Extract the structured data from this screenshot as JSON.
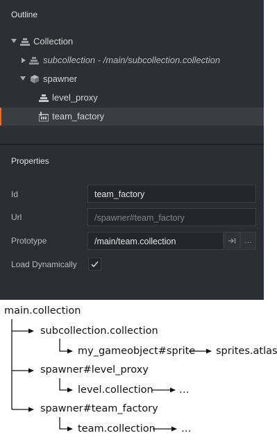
{
  "outline": {
    "title": "Outline",
    "items": [
      {
        "label": "Collection",
        "icon": "collection-icon",
        "expanded": true,
        "italic": false
      },
      {
        "label": "subcollection - /main/subcollection.collection",
        "icon": "collection-icon",
        "expanded": false,
        "italic": true
      },
      {
        "label": "spawner",
        "icon": "gameobject-cube-icon",
        "expanded": true,
        "italic": false
      },
      {
        "label": "level_proxy",
        "icon": "collection-proxy-icon",
        "expanded": false,
        "italic": false
      },
      {
        "label": "team_factory",
        "icon": "factory-icon",
        "expanded": false,
        "italic": false,
        "selected": true
      }
    ]
  },
  "properties": {
    "title": "Properties",
    "id": {
      "label": "Id",
      "value": "team_factory"
    },
    "url": {
      "label": "Url",
      "value": "/spawner#team_factory"
    },
    "prototype": {
      "label": "Prototype",
      "value": "/main/team.collection",
      "open_icon": "open-file-icon",
      "browse_label": "…"
    },
    "load_dynamically": {
      "label": "Load Dynamically",
      "checked": true
    }
  },
  "colors": {
    "panel_bg": "#2c2f33",
    "selection_accent": "#e06c2a",
    "text": "#d6d6d6"
  },
  "diagram": {
    "root": "main.collection",
    "n1": "subcollection.collection",
    "n1a": "my_gameobject#sprite",
    "n1b": "sprites.atlas",
    "n2": "spawner#level_proxy",
    "n2a": "level.collection",
    "n2b": "…",
    "n3": "spawner#team_factory",
    "n3a": "team.collection",
    "n3b": "…"
  }
}
